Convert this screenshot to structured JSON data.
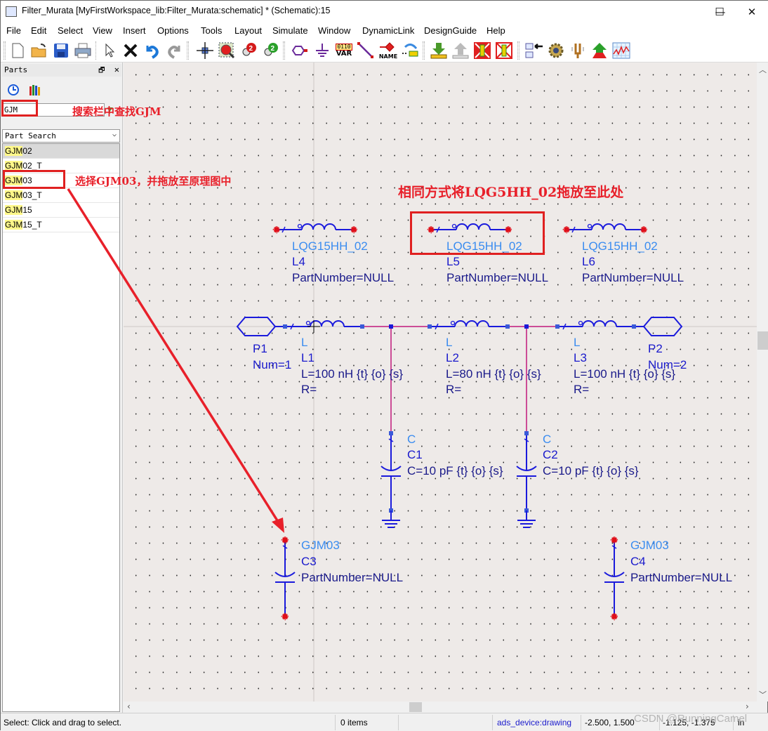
{
  "window": {
    "title": "Filter_Murata [MyFirstWorkspace_lib:Filter_Murata:schematic] * (Schematic):15",
    "controls": {
      "minimize": "—",
      "maximize": "☐",
      "close": "✕"
    }
  },
  "menu": [
    "File",
    "Edit",
    "Select",
    "View",
    "Insert",
    "Options",
    "Tools",
    "Layout",
    "Simulate",
    "Window",
    "DynamicLink",
    "DesignGuide",
    "Help"
  ],
  "toolbar": {
    "var_top": "0110",
    "var_bottom": "VAR",
    "name_label": "NAME",
    "icons": [
      "new-file-icon",
      "open-folder-icon",
      "save-icon",
      "print-icon",
      "select-arrow-icon",
      "delete-icon",
      "undo-icon",
      "redo-icon",
      "pan-icon",
      "zoom-area-icon",
      "zoom-in-icon",
      "zoom-out-icon",
      "port-icon",
      "ground-icon",
      "var-icon",
      "wire-icon",
      "name-icon",
      "move-component-icon",
      "push-into-icon",
      "pop-out-icon",
      "deactivate-icon",
      "short-icon",
      "generate-symbol-icon",
      "simulate-settings-icon",
      "tuning-icon",
      "optimize-icon",
      "data-display-icon"
    ]
  },
  "parts_panel": {
    "title": "Parts",
    "dock_icon": "🗗",
    "close_icon": "✕",
    "search_value": "GJM",
    "library_select": "Part Search",
    "results": [
      {
        "match": "GJM",
        "rest": "02",
        "selected": true
      },
      {
        "match": "GJM",
        "rest": "02_T",
        "selected": false
      },
      {
        "match": "GJM",
        "rest": "03",
        "selected": false
      },
      {
        "match": "GJM",
        "rest": "03_T",
        "selected": false
      },
      {
        "match": "GJM",
        "rest": "15",
        "selected": false
      },
      {
        "match": "GJM",
        "rest": "15_T",
        "selected": false
      }
    ]
  },
  "annotations": {
    "search_hint": "搜索栏中查找GJM",
    "select_hint": "选择GJM03，并拖放至原理图中",
    "same_hint": "相同方式将LQG5HH_02拖放至此处"
  },
  "schematic": {
    "colors": {
      "wire": "#c0187a",
      "component": "#1a1adc",
      "label_model": "#3a8cf0",
      "label": "#1a1acc",
      "pin": "#e0101a"
    },
    "top_inductors": [
      {
        "model": "LQG15HH_02",
        "ref": "L4",
        "param": "PartNumber=NULL"
      },
      {
        "model": "LQG15HH_02",
        "ref": "L5",
        "param": "PartNumber=NULL"
      },
      {
        "model": "LQG15HH_02",
        "ref": "L6",
        "param": "PartNumber=NULL"
      }
    ],
    "ports": [
      {
        "ref": "P1",
        "num": "Num=1"
      },
      {
        "ref": "P2",
        "num": "Num=2"
      }
    ],
    "series_inductors": [
      {
        "type": "L",
        "ref": "L1",
        "value": "L=100 nH {t} {o} {s}",
        "r": "R="
      },
      {
        "type": "L",
        "ref": "L2",
        "value": "L=80 nH {t} {o} {s}",
        "r": "R="
      },
      {
        "type": "L",
        "ref": "L3",
        "value": "L=100 nH {t} {o} {s}",
        "r": "R="
      }
    ],
    "shunt_caps": [
      {
        "type": "C",
        "ref": "C1",
        "value": "C=10 pF {t} {o} {s}"
      },
      {
        "type": "C",
        "ref": "C2",
        "value": "C=10 pF {t} {o} {s}"
      }
    ],
    "murata_caps": [
      {
        "model": "GJM03",
        "ref": "C3",
        "param": "PartNumber=NULL"
      },
      {
        "model": "GJM03",
        "ref": "C4",
        "param": "PartNumber=NULL"
      }
    ]
  },
  "status": {
    "hint": "Select: Click and drag to select.",
    "items": "0 items",
    "layer": "ads_device:drawing",
    "coord1": "-2.500, 1.500",
    "coord2": "-1.125, -1.375",
    "unit": "in",
    "watermark": "CSDN @RunningCamel"
  }
}
